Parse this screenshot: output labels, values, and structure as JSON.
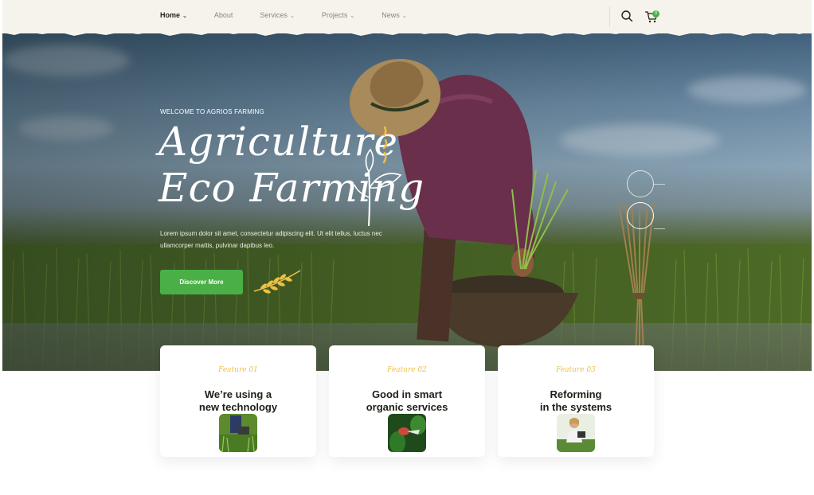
{
  "nav": {
    "items": [
      {
        "label": "Home",
        "has_dropdown": true,
        "active": true
      },
      {
        "label": "About",
        "has_dropdown": false,
        "active": false
      },
      {
        "label": "Services",
        "has_dropdown": true,
        "active": false
      },
      {
        "label": "Projects",
        "has_dropdown": true,
        "active": false
      },
      {
        "label": "News",
        "has_dropdown": true,
        "active": false
      }
    ],
    "search_icon": "search-icon",
    "cart_icon": "cart-icon",
    "cart_count": "0"
  },
  "hero": {
    "eyebrow": "WELCOME TO AGRIOS FARMING",
    "title_line1": "Agriculture",
    "title_line2": "Eco Farming",
    "description": "Lorem ipsum dolor sit amet, consectetur adipiscing elit. Ut elit tellus, luctus nec ullamcorper mattis, pulvinar dapibus leo.",
    "cta_label": "Discover More",
    "slide_count": 2,
    "active_slide": 2
  },
  "features": [
    {
      "eyebrow": "Feature 01",
      "title": "We’re using a\nnew technology",
      "image": "person-holding-tablet-in-field"
    },
    {
      "eyebrow": "Feature 02",
      "title": "Good in smart\norganic services",
      "image": "hand-pruning-plants"
    },
    {
      "eyebrow": "Feature 03",
      "title": "Reforming\nin the systems",
      "image": "woman-with-tablet-in-crops"
    }
  ],
  "colors": {
    "accent_green": "#4baf47",
    "accent_yellow": "#eec044",
    "nav_bg": "#f6f3ec",
    "text_dark": "#1f1e17"
  }
}
